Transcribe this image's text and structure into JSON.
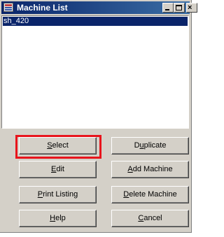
{
  "window": {
    "title": "Machine List",
    "icon": "app-grid-icon",
    "controls": {
      "minimize": "minimize-icon",
      "maximize": "maximize-icon",
      "close": "close-icon"
    }
  },
  "list": {
    "items": [
      {
        "label": "sh_420",
        "selected": true
      }
    ]
  },
  "buttons": {
    "select": {
      "pre": "",
      "key": "S",
      "post": "elect"
    },
    "duplicate": {
      "pre": "D",
      "key": "u",
      "post": "plicate"
    },
    "edit": {
      "pre": "",
      "key": "E",
      "post": "dit"
    },
    "add_machine": {
      "pre": "",
      "key": "A",
      "post": "dd Machine"
    },
    "print_listing": {
      "pre": "",
      "key": "P",
      "post": "rint Listing"
    },
    "delete_machine": {
      "pre": "",
      "key": "D",
      "post": "elete Machine"
    },
    "help": {
      "pre": "",
      "key": "H",
      "post": "elp"
    },
    "cancel": {
      "pre": "",
      "key": "C",
      "post": "ancel"
    }
  },
  "colors": {
    "highlight": "#e8141c",
    "titlebar_start": "#0a246a",
    "titlebar_end": "#3a6ea5",
    "selection": "#0a246a",
    "face": "#d4d0c8"
  }
}
